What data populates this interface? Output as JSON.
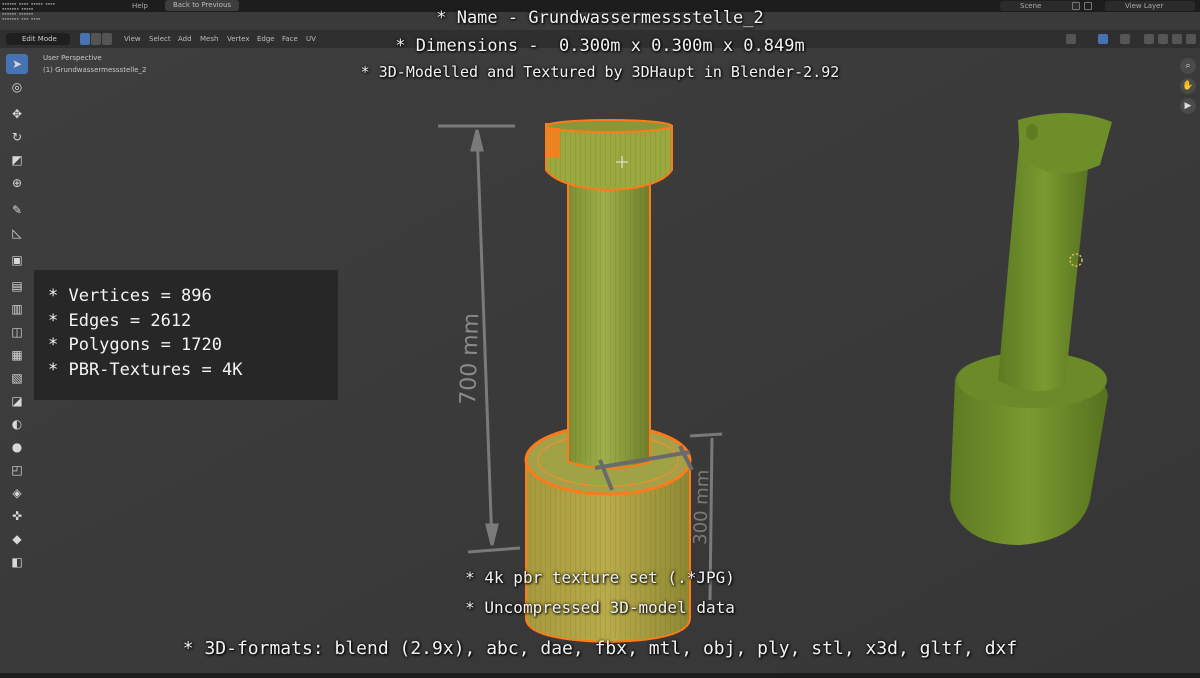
{
  "topbar": {
    "menu_help": "Help",
    "back_button": "Back to Previous",
    "scene_label": "Scene",
    "view_layer_label": "View Layer"
  },
  "header": {
    "mode": "Edit Mode",
    "menus": [
      "View",
      "Select",
      "Add",
      "Mesh",
      "Vertex",
      "Edge",
      "Face",
      "UV"
    ]
  },
  "viewport": {
    "perspective": "User Perspective",
    "object_name": "(1) Grundwassermessstelle_2"
  },
  "overlay": {
    "title": "* Name - Grundwassermessstelle_2",
    "dimensions": "* Dimensions -  0.300m x 0.300m x 0.849m",
    "credit": "* 3D-Modelled and Textured by 3DHaupt in Blender-2.92",
    "stats": [
      "* Vertices = 896",
      "* Edges = 2612",
      "* Polygons = 1720",
      "* PBR-Textures = 4K"
    ],
    "texture_set": "* 4k pbr texture set (.*JPG)",
    "uncompressed": "* Uncompressed 3D-model data",
    "formats": "* 3D-formats: blend (2.9x), abc, dae, fbx, mtl, obj, ply, stl, x3d, gltf, dxf"
  },
  "dimension_labels": {
    "height": "700 mm",
    "base_height": "300 mm",
    "diameter": "300 mm"
  },
  "toolbar_icons": [
    "select-box-icon",
    "cursor-icon",
    "move-icon",
    "rotate-icon",
    "scale-icon",
    "transform-icon",
    "annotate-icon",
    "measure-icon",
    "add-cube-icon",
    "extrude-icon",
    "inset-icon",
    "bevel-icon",
    "loop-cut-icon",
    "knife-icon",
    "poly-build-icon",
    "spin-icon",
    "smooth-icon",
    "randomize-icon",
    "edge-slide-icon",
    "shrink-icon",
    "shear-icon",
    "rip-icon"
  ],
  "colors": {
    "viewport_bg": "#3a3a3a",
    "accent": "#4772b3",
    "mesh_green": "#8aa13c",
    "selection_orange": "#ff7a1a"
  }
}
